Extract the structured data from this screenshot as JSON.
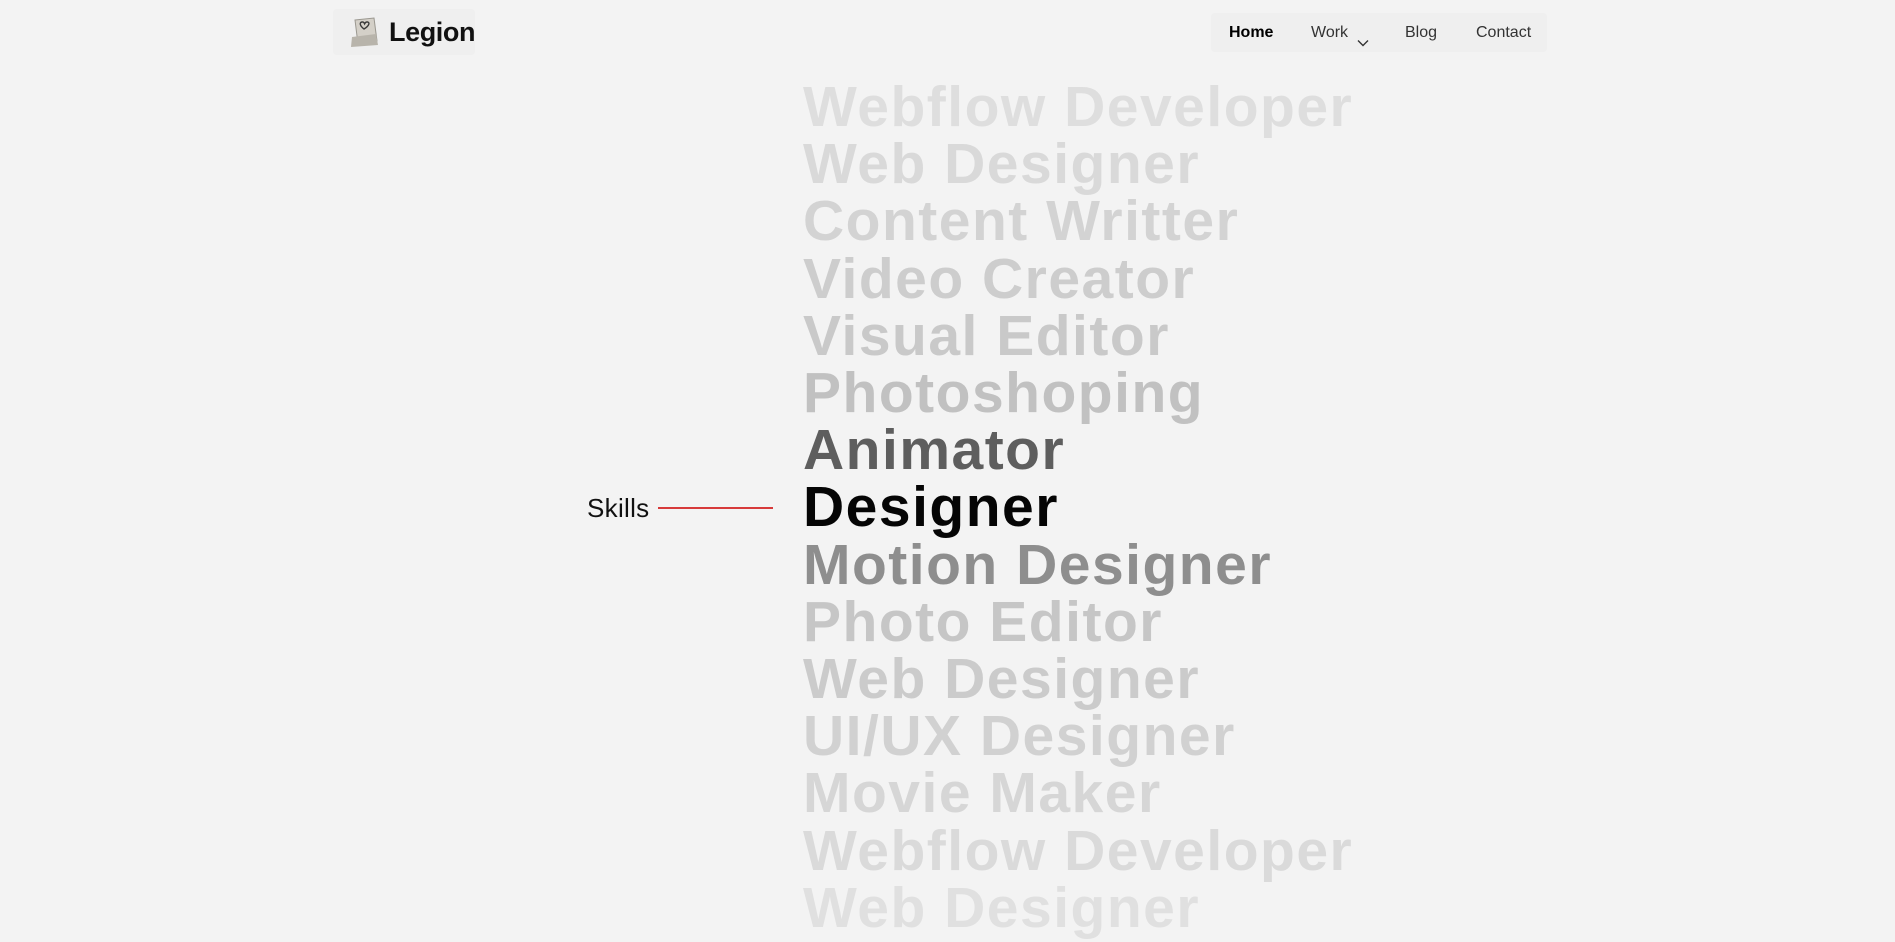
{
  "brand": {
    "name": "Legion",
    "icon": "photo-heart-icon"
  },
  "nav": {
    "items": [
      {
        "label": "Home",
        "active": true
      },
      {
        "label": "Work",
        "has_dropdown": true,
        "dropdown_icon": "chevron-down-icon"
      },
      {
        "label": "Blog"
      },
      {
        "label": "Contact"
      }
    ]
  },
  "skills": {
    "label": "Skills",
    "accent_color": "#d73a3a",
    "words": [
      {
        "text": "Webflow Developer",
        "color": "#dedede"
      },
      {
        "text": "Web Designer",
        "color": "#d9d9d9"
      },
      {
        "text": "Content Writter",
        "color": "#d3d3d3"
      },
      {
        "text": "Video Creator",
        "color": "#cdcdcd"
      },
      {
        "text": "Visual Editor",
        "color": "#c9c9c9"
      },
      {
        "text": "Photoshoping",
        "color": "#c1c1c1"
      },
      {
        "text": "Animator",
        "color": "#5e5e5e"
      },
      {
        "text": "Designer",
        "color": "#050505"
      },
      {
        "text": "Motion Designer",
        "color": "#8e8e8e"
      },
      {
        "text": "Photo Editor",
        "color": "#c6c6c6"
      },
      {
        "text": "Web Designer",
        "color": "#cbcbcb"
      },
      {
        "text": "UI/UX Designer",
        "color": "#d1d1d1"
      },
      {
        "text": "Movie Maker",
        "color": "#d6d6d6"
      },
      {
        "text": "Webflow Developer",
        "color": "#dadada"
      },
      {
        "text": "Web Designer",
        "color": "#e0e0e0"
      }
    ]
  }
}
